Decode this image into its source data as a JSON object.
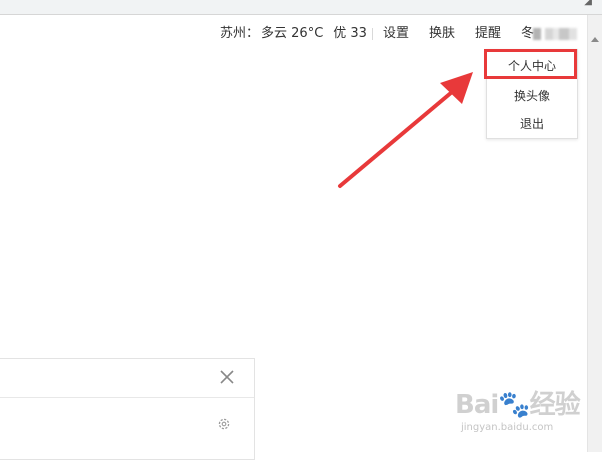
{
  "header": {
    "weather": {
      "city": "苏州：",
      "condition": "多云 26°C",
      "air_quality": "优 33"
    },
    "links": {
      "settings": "设置",
      "skin": "换肤",
      "reminder": "提醒"
    },
    "username_prefix": "冬"
  },
  "user_menu": {
    "items": [
      "个人中心",
      "换头像",
      "退出"
    ],
    "highlighted_index": 0
  },
  "annotation": {
    "color": "#e8393a"
  },
  "watermark": {
    "logo": "Bai🐾经验",
    "url": "jingyan.baidu.com"
  },
  "icons": {
    "close": "close-icon",
    "settings": "gear-icon"
  }
}
